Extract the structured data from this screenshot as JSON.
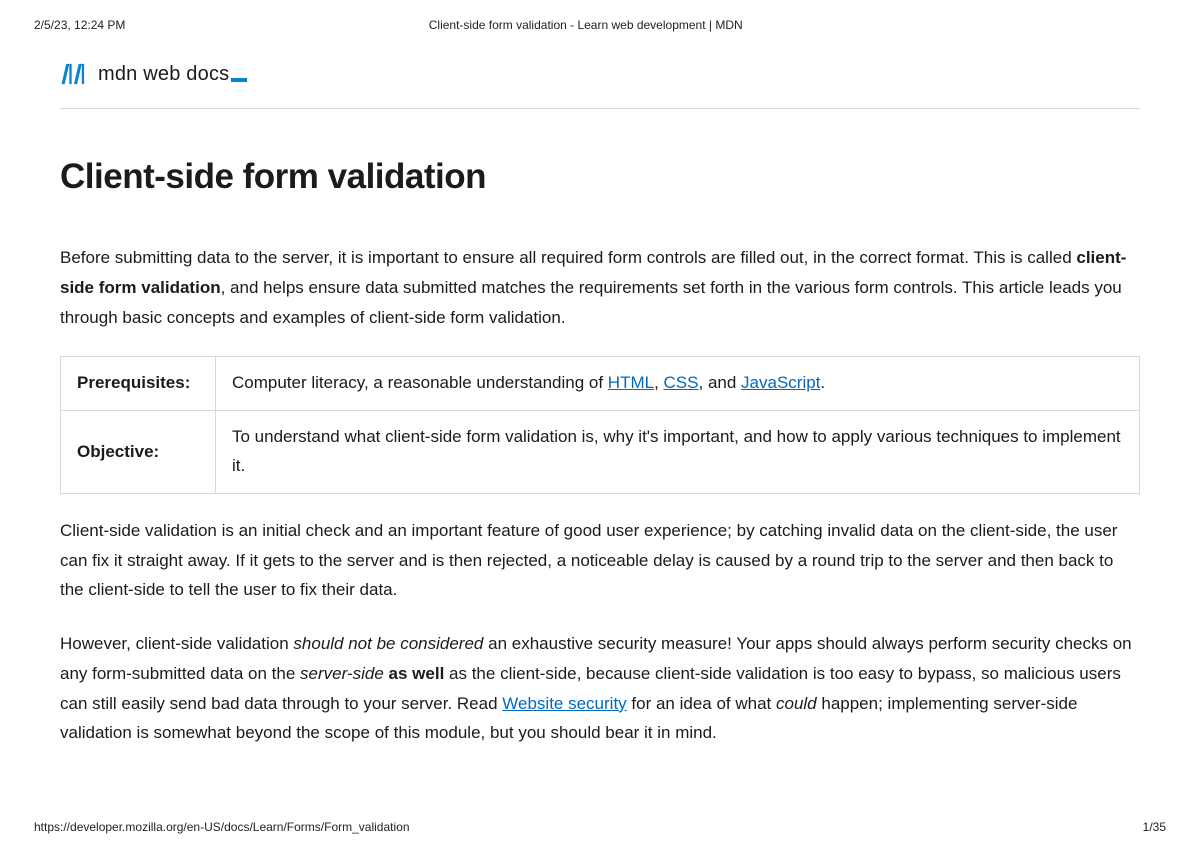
{
  "print": {
    "timestamp": "2/5/23, 12:24 PM",
    "doc_title": "Client-side form validation - Learn web development | MDN",
    "url": "https://developer.mozilla.org/en-US/docs/Learn/Forms/Form_validation",
    "page_indicator": "1/35"
  },
  "brand": {
    "name": "mdn web docs"
  },
  "page": {
    "title": "Client-side form validation",
    "intro_before_bold": "Before submitting data to the server, it is important to ensure all required form controls are filled out, in the correct format. This is called ",
    "intro_bold": "client-side form validation",
    "intro_after_bold": ", and helps ensure data submitted matches the requirements set forth in the various form controls. This article leads you through basic concepts and examples of client-side form validation."
  },
  "table": {
    "prereq_label": "Prerequisites:",
    "prereq_before": "Computer literacy, a reasonable understanding of ",
    "prereq_link1": "HTML",
    "prereq_sep1": ", ",
    "prereq_link2": "CSS",
    "prereq_sep2": ", and ",
    "prereq_link3": "JavaScript",
    "prereq_after": ".",
    "objective_label": "Objective:",
    "objective_text": "To understand what client-side form validation is, why it's important, and how to apply various techniques to implement it."
  },
  "para2": "Client-side validation is an initial check and an important feature of good user experience; by catching invalid data on the client-side, the user can fix it straight away. If it gets to the server and is then rejected, a noticeable delay is caused by a round trip to the server and then back to the client-side to tell the user to fix their data.",
  "para3": {
    "p1": "However, client-side validation ",
    "em1": "should not be considered",
    "p2": " an exhaustive security measure! Your apps should always perform security checks on any form-submitted data on the ",
    "em2": "server-side",
    "p3": " ",
    "bold1": "as well",
    "p4": " as the client-side, because client-side validation is too easy to bypass, so malicious users can still easily send bad data through to your server. Read ",
    "link1": "Website security",
    "p5": " for an idea of what ",
    "em3": "could",
    "p6": " happen; implementing server-side validation is somewhat beyond the scope of this module, but you should bear it in mind."
  }
}
